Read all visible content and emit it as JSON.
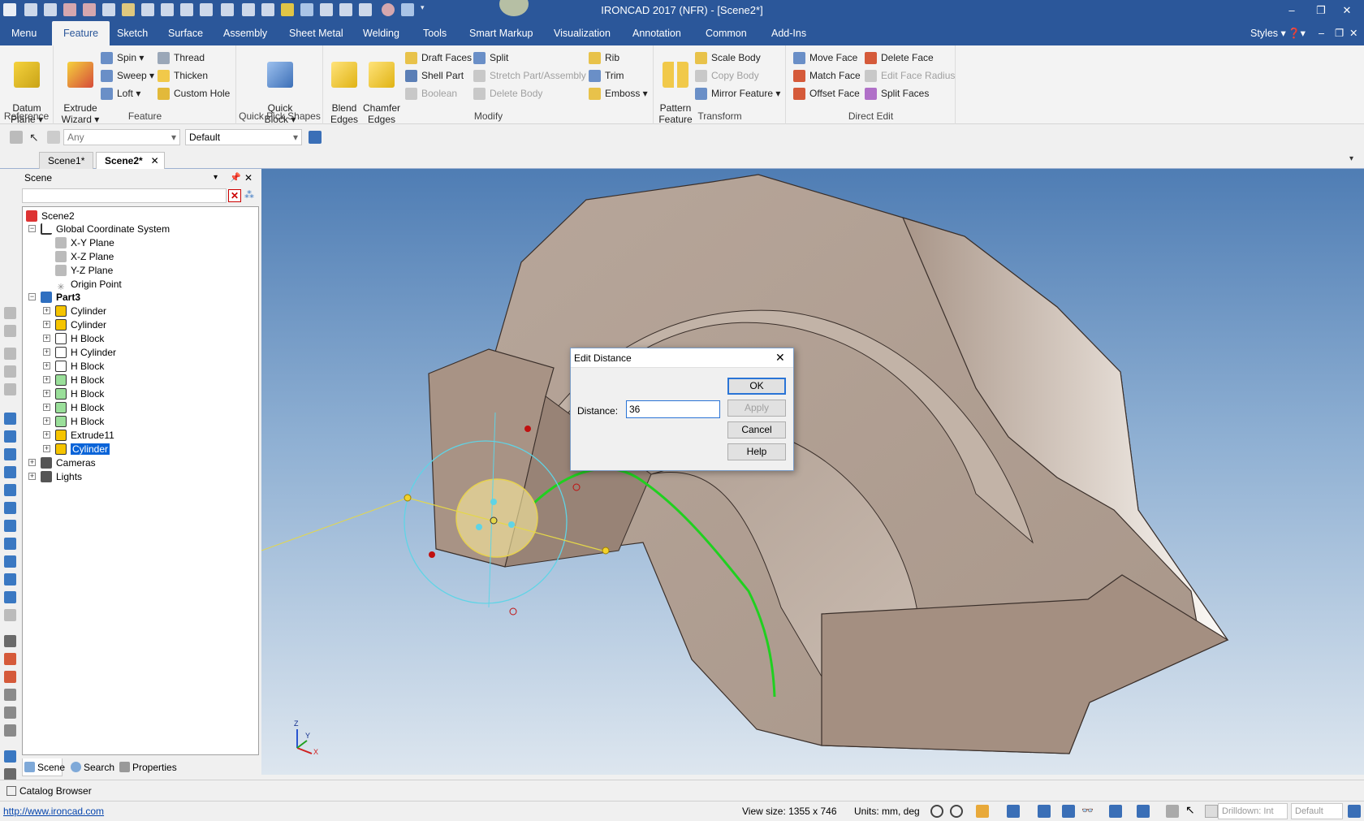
{
  "window": {
    "title": "IRONCAD 2017 (NFR) - [Scene2*]"
  },
  "menu_tabs": [
    "Menu",
    "Feature",
    "Sketch",
    "Surface",
    "Assembly",
    "Sheet Metal",
    "Welding",
    "Tools",
    "Smart Markup",
    "Visualization",
    "Annotation",
    "Common",
    "Add-Ins"
  ],
  "menu_right": {
    "styles": "Styles"
  },
  "ribbon": {
    "reference": {
      "label": "Reference",
      "datum_plane": "Datum\nPlane ▾"
    },
    "feature": {
      "label": "Feature",
      "extrude_wizard": "Extrude\nWizard ▾",
      "spin": "Spin ▾",
      "sweep": "Sweep ▾",
      "loft": "Loft ▾",
      "thread": "Thread",
      "thicken": "Thicken",
      "custom_hole": "Custom Hole"
    },
    "quick_pick": {
      "label": "Quick Pick Shapes",
      "quick_block": "Quick\nBlock ▾"
    },
    "modify": {
      "label": "Modify",
      "blend_edges": "Blend\nEdges",
      "chamfer_edges": "Chamfer\nEdges",
      "draft_faces": "Draft Faces",
      "shell_part": "Shell Part",
      "boolean": "Boolean",
      "split": "Split",
      "stretch": "Stretch Part/Assembly",
      "delete_body": "Delete Body",
      "rib": "Rib",
      "trim": "Trim",
      "emboss": "Emboss ▾"
    },
    "transform": {
      "label": "Transform",
      "pattern_feature": "Pattern\nFeature",
      "scale_body": "Scale Body",
      "copy_body": "Copy Body",
      "mirror_feature": "Mirror Feature ▾"
    },
    "direct_edit": {
      "label": "Direct Edit",
      "move_face": "Move Face",
      "match_face": "Match Face",
      "offset_face": "Offset Face",
      "delete_face": "Delete Face",
      "edit_face_radius": "Edit Face Radius",
      "split_faces": "Split Faces"
    }
  },
  "toolbar2": {
    "filter": "Any",
    "style": "Default"
  },
  "doc_tabs": [
    {
      "label": "Scene1*"
    },
    {
      "label": "Scene2*"
    }
  ],
  "scene_panel": {
    "title": "Scene",
    "tree": [
      {
        "label": "Scene2"
      },
      {
        "label": "Global Coordinate System"
      },
      {
        "label": "X-Y Plane"
      },
      {
        "label": "X-Z Plane"
      },
      {
        "label": "Y-Z Plane"
      },
      {
        "label": "Origin Point"
      },
      {
        "label": "Part3"
      },
      {
        "label": "Cylinder"
      },
      {
        "label": "Cylinder"
      },
      {
        "label": "H Block"
      },
      {
        "label": "H Cylinder"
      },
      {
        "label": "H Block"
      },
      {
        "label": "H Block"
      },
      {
        "label": "H Block"
      },
      {
        "label": "H Block"
      },
      {
        "label": "H Block"
      },
      {
        "label": "Extrude11"
      },
      {
        "label": "Cylinder"
      },
      {
        "label": "Cameras"
      },
      {
        "label": "Lights"
      }
    ],
    "tabs": [
      "Scene",
      "Search",
      "Properties"
    ]
  },
  "dialog": {
    "title": "Edit Distance",
    "distance_label": "Distance:",
    "distance_value": "36",
    "ok": "OK",
    "apply": "Apply",
    "cancel": "Cancel",
    "help": "Help"
  },
  "axis": {
    "z": "Z",
    "y": "Y",
    "x": "X"
  },
  "catalog": {
    "label": "Catalog Browser"
  },
  "status": {
    "url": "http://www.ironcad.com",
    "view_size": "View size: 1355 x  746",
    "units": "Units: mm, deg",
    "drilldown": "Drilldown: Int",
    "default": "Default"
  }
}
